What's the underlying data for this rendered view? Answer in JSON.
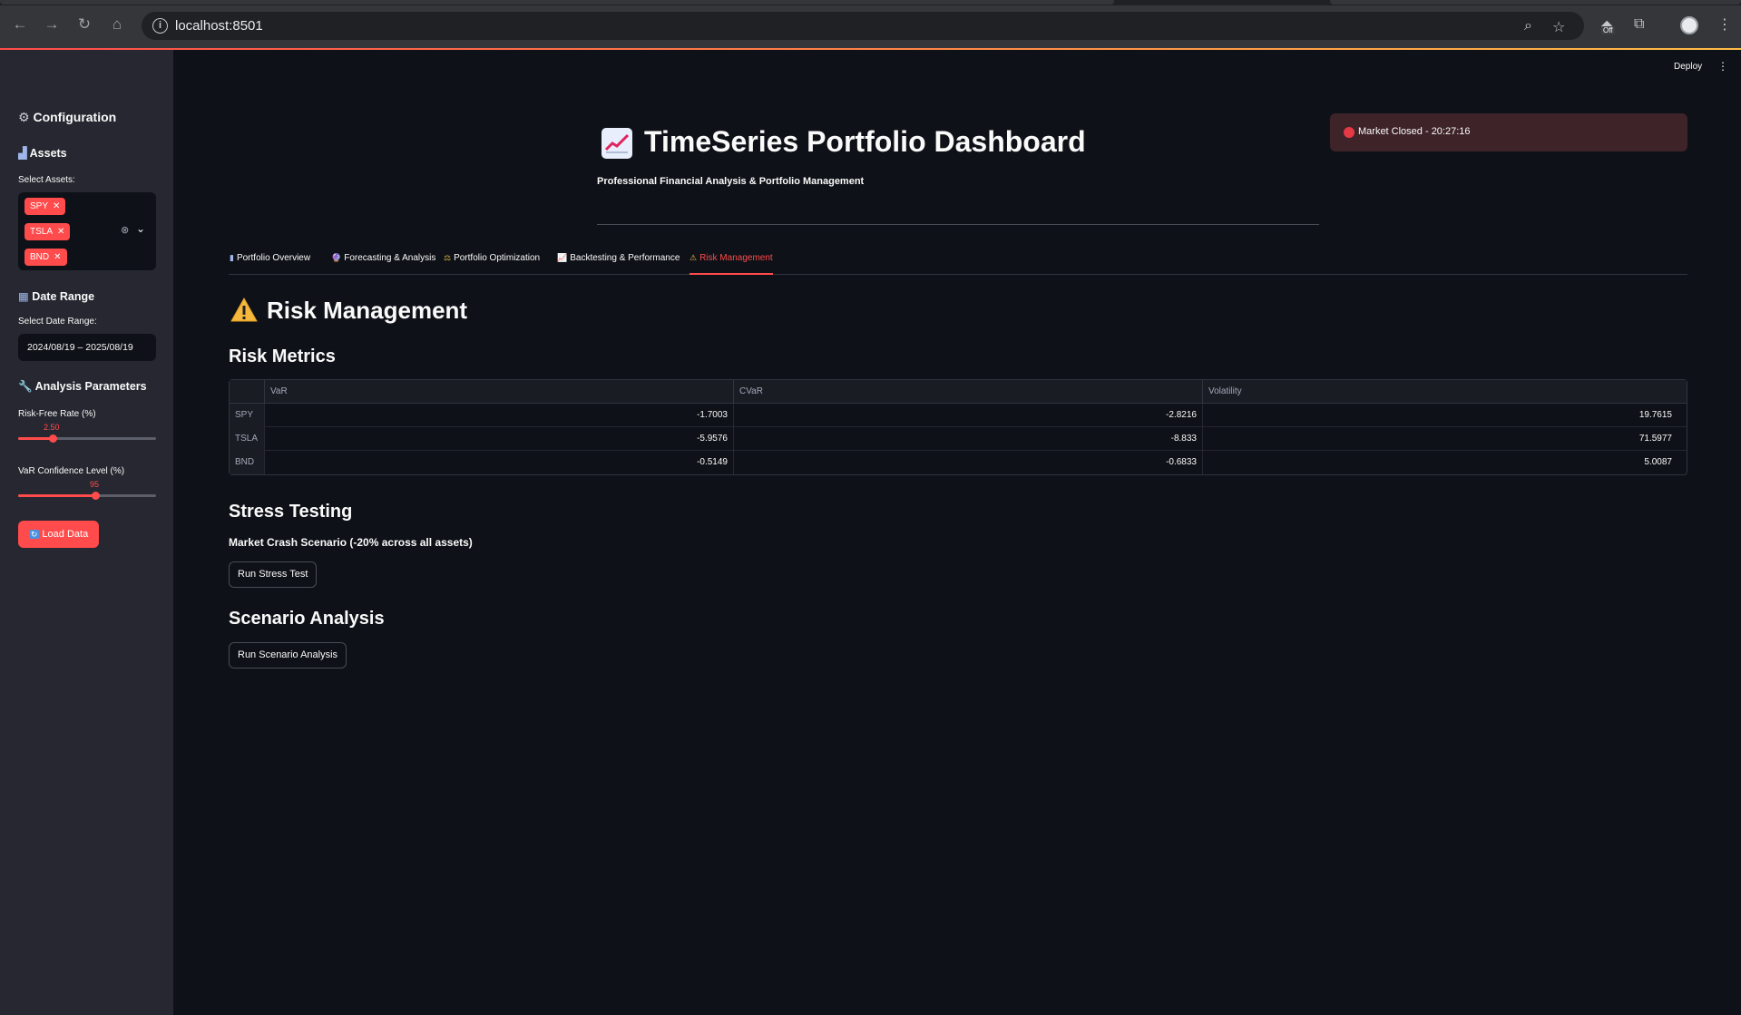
{
  "browser": {
    "url": "localhost:8501",
    "extension_badge": "Off"
  },
  "app": {
    "deploy_label": "Deploy",
    "menu_glyph": "⋮"
  },
  "sidebar": {
    "config_title": "Configuration",
    "assets_title": "Assets",
    "select_assets_label": "Select Assets:",
    "assets": [
      "SPY",
      "TSLA",
      "BND"
    ],
    "date_range_title": "Date Range",
    "select_date_label": "Select Date Range:",
    "date_range_value": "2024/08/19 – 2025/08/19",
    "analysis_title": "Analysis Parameters",
    "risk_free_label": "Risk-Free Rate (%)",
    "risk_free_value": "2.50",
    "risk_free_fraction": 0.25,
    "var_conf_label": "VaR Confidence Level (%)",
    "var_conf_value": "95",
    "var_conf_fraction": 0.56,
    "load_button": "Load Data"
  },
  "header": {
    "title": "TimeSeries Portfolio Dashboard",
    "subtitle": "Professional Financial Analysis & Portfolio Management",
    "status_text": "Market Closed - 20:27:16"
  },
  "tabs": [
    {
      "icon": "▮",
      "label": "Portfolio Overview"
    },
    {
      "icon": "🔮",
      "label": "Forecasting & Analysis"
    },
    {
      "icon": "⚖",
      "label": "Portfolio Optimization"
    },
    {
      "icon": "📈",
      "label": "Backtesting & Performance"
    },
    {
      "icon": "⚠",
      "label": "Risk Management"
    }
  ],
  "risk": {
    "page_heading": "Risk Management",
    "metrics_heading": "Risk Metrics",
    "columns": [
      "VaR",
      "CVaR",
      "Volatility"
    ],
    "rows": [
      {
        "asset": "SPY",
        "var": "-1.7003",
        "cvar": "-2.8216",
        "vol": "19.7615"
      },
      {
        "asset": "TSLA",
        "var": "-5.9576",
        "cvar": "-8.833",
        "vol": "71.5977"
      },
      {
        "asset": "BND",
        "var": "-0.5149",
        "cvar": "-0.6833",
        "vol": "5.0087"
      }
    ],
    "stress_heading": "Stress Testing",
    "stress_scenario": "Market Crash Scenario (-20% across all assets)",
    "stress_button": "Run Stress Test",
    "scenario_heading": "Scenario Analysis",
    "scenario_button": "Run Scenario Analysis"
  },
  "colors": {
    "accent": "#ff4b4b",
    "background": "#0e1117",
    "sidebar": "#262730"
  }
}
